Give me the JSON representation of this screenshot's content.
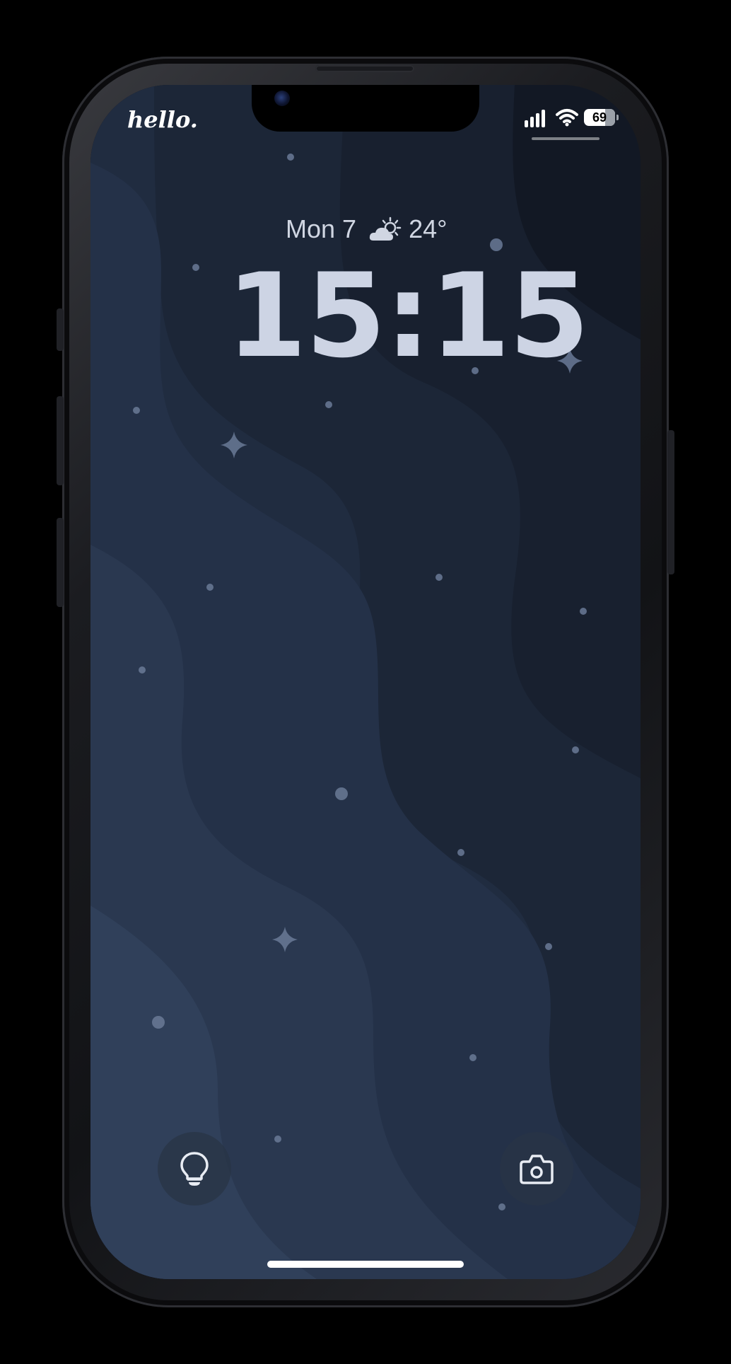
{
  "status_bar": {
    "carrier": "hello.",
    "battery_level": 69,
    "battery_label": "69",
    "signal_icon": "cellular-signal-icon",
    "wifi_icon": "wifi-icon",
    "battery_icon": "battery-icon"
  },
  "lock_screen": {
    "date": "Mon 7",
    "weather_icon": "partly-cloudy-icon",
    "temperature": "24°",
    "time": "15:15"
  },
  "quick_actions": {
    "flashlight_icon": "flashlight-icon",
    "camera_icon": "camera-icon"
  },
  "colors": {
    "clock_text": "#cdd4e4",
    "wallpaper_dark": "#141b28",
    "wallpaper_light": "#34445e"
  }
}
